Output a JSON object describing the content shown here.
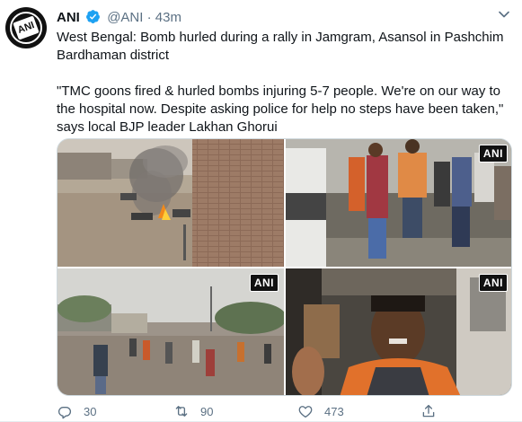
{
  "tweet": {
    "author_name": "ANI",
    "handle": "@ANI",
    "separator": "·",
    "time": "43m",
    "text_line1": "West Bengal: Bomb hurled during a rally in Jamgram, Asansol in Pashchim Bardhaman district",
    "text_line2": "\"TMC goons fired & hurled bombs injuring 5-7 people. We're on our way to the hospital now. Despite asking police for help no steps have been taken,\" says local BJP leader Lakhan Ghorui"
  },
  "avatar": {
    "logo_text": "ANI"
  },
  "media": {
    "watermark": "ANI",
    "icons": [
      "fire-smoke-scene",
      "crowd-scene",
      "street-crowd-scene",
      "man-in-vehicle-scene"
    ]
  },
  "actions": {
    "reply_count": "30",
    "retweet_count": "90",
    "like_count": "473"
  },
  "colors": {
    "verified": "#1da1f2",
    "muted": "#5b7083",
    "border": "#cfd9de"
  }
}
